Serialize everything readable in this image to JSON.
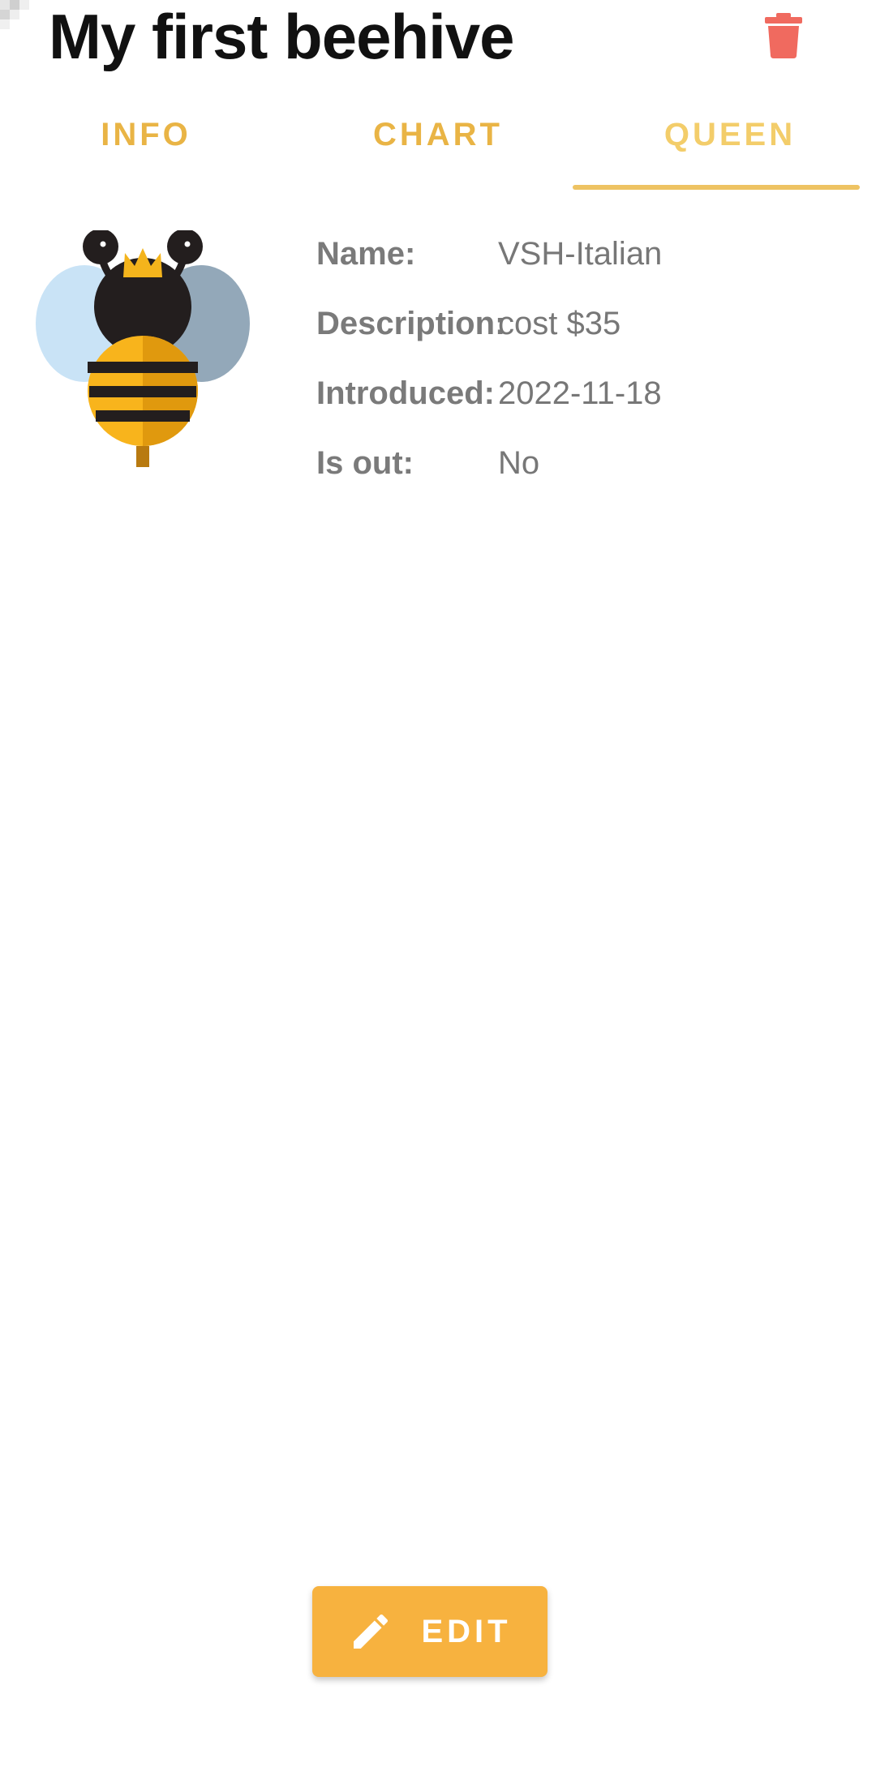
{
  "header": {
    "title": "My first beehive",
    "delete_icon": "trash-icon",
    "delete_color": "#f06a5f"
  },
  "tabs": [
    {
      "label": "INFO",
      "active": false
    },
    {
      "label": "CHART",
      "active": false
    },
    {
      "label": "QUEEN",
      "active": true
    }
  ],
  "queen": {
    "image_icon": "queen-bee-icon",
    "fields": [
      {
        "label": "Name:",
        "value": "VSH-Italian"
      },
      {
        "label": "Description:",
        "value": "cost $35"
      },
      {
        "label": "Introduced:",
        "value": "2022-11-18"
      },
      {
        "label": "Is out:",
        "value": "No"
      }
    ]
  },
  "footer": {
    "edit_label": "EDIT",
    "edit_icon": "pencil-icon",
    "accent_color": "#f7b23f"
  },
  "colors": {
    "tab_text": "#e9b445",
    "tab_active": "#f3cd6a",
    "title": "#111111",
    "field_text": "#777777"
  }
}
